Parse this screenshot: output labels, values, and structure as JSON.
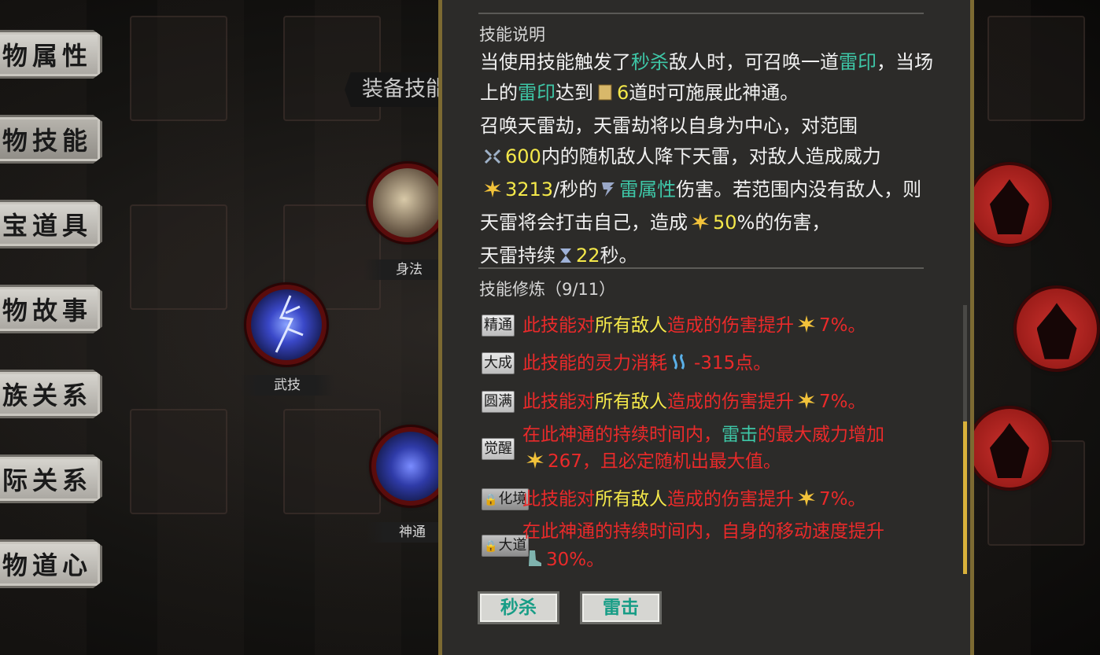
{
  "menu": {
    "items": [
      {
        "label": "人物属性"
      },
      {
        "label": "人物技能"
      },
      {
        "label": "法宝道具"
      },
      {
        "label": "人物故事"
      },
      {
        "label": "家族关系"
      },
      {
        "label": "人际关系"
      },
      {
        "label": "人物道心"
      }
    ]
  },
  "equip": {
    "title": "装备技能",
    "slots": [
      {
        "label": "身法"
      },
      {
        "label": "武技"
      },
      {
        "label": "神通"
      }
    ]
  },
  "skill_panel": {
    "desc_title": "技能说明",
    "desc": {
      "p1a": "当使用技能触发了",
      "kw_miaosha": "秒杀",
      "p1b": "敌人时，可召唤一道",
      "kw_leiyin": "雷印",
      "p1c": "，当场上的",
      "kw_leiyin2": "雷印",
      "p1d": "达到",
      "count": "6",
      "p1e": "道时可施展此神通。",
      "p2": "召唤天雷劫，天雷劫将以自身为中心，对范围",
      "range": "600",
      "p3": "内的随机敌人降下天雷，对敌人造成威力",
      "power": "3213",
      "p4": "/秒的",
      "element": "雷属性",
      "p5": "伤害。若范围内没有敌人，则天雷将会打击自己，造成",
      "self_pct": "50",
      "p6": "%的伤害，",
      "p7": "天雷持续",
      "duration": "22",
      "p8": "秒。"
    },
    "train_title": "技能修炼（9/11）",
    "train": [
      {
        "tag": "精通",
        "locked": false,
        "t1": "此技能对",
        "y1": "所有敌人",
        "t2": "造成的伤害提升",
        "v": "7%。"
      },
      {
        "tag": "大成",
        "locked": false,
        "t1": "此技能的灵力消耗",
        "v": "-315点。"
      },
      {
        "tag": "圆满",
        "locked": false,
        "t1": "此技能对",
        "y1": "所有敌人",
        "t2": "造成的伤害提升",
        "v": "7%。"
      },
      {
        "tag": "觉醒",
        "locked": false,
        "l1a": "在此神通的持续时间内，",
        "g1": "雷击",
        "l1b": "的最大威力增加",
        "l2": "267，且必定随机出最大值。"
      },
      {
        "tag": "化境",
        "locked": true,
        "t1": "此技能对",
        "y1": "所有敌人",
        "t2": "造成的伤害提升",
        "v": "7%。"
      },
      {
        "tag": "大道",
        "locked": true,
        "l1": "在此神通的持续时间内，自身的移动速度提升",
        "l2": "30%。"
      }
    ],
    "keywords": [
      "秒杀",
      "雷击"
    ]
  },
  "colors": {
    "keyword_green": "#3ec7a7",
    "value_yellow": "#f4e84a",
    "upgrade_red": "#ea2a2a",
    "panel_border": "#7c6a32"
  },
  "icons": [
    "scroll-icon",
    "range-icon",
    "burst-icon",
    "thunder-element-icon",
    "hourglass-icon",
    "mana-icon",
    "boot-icon",
    "lock-icon"
  ]
}
